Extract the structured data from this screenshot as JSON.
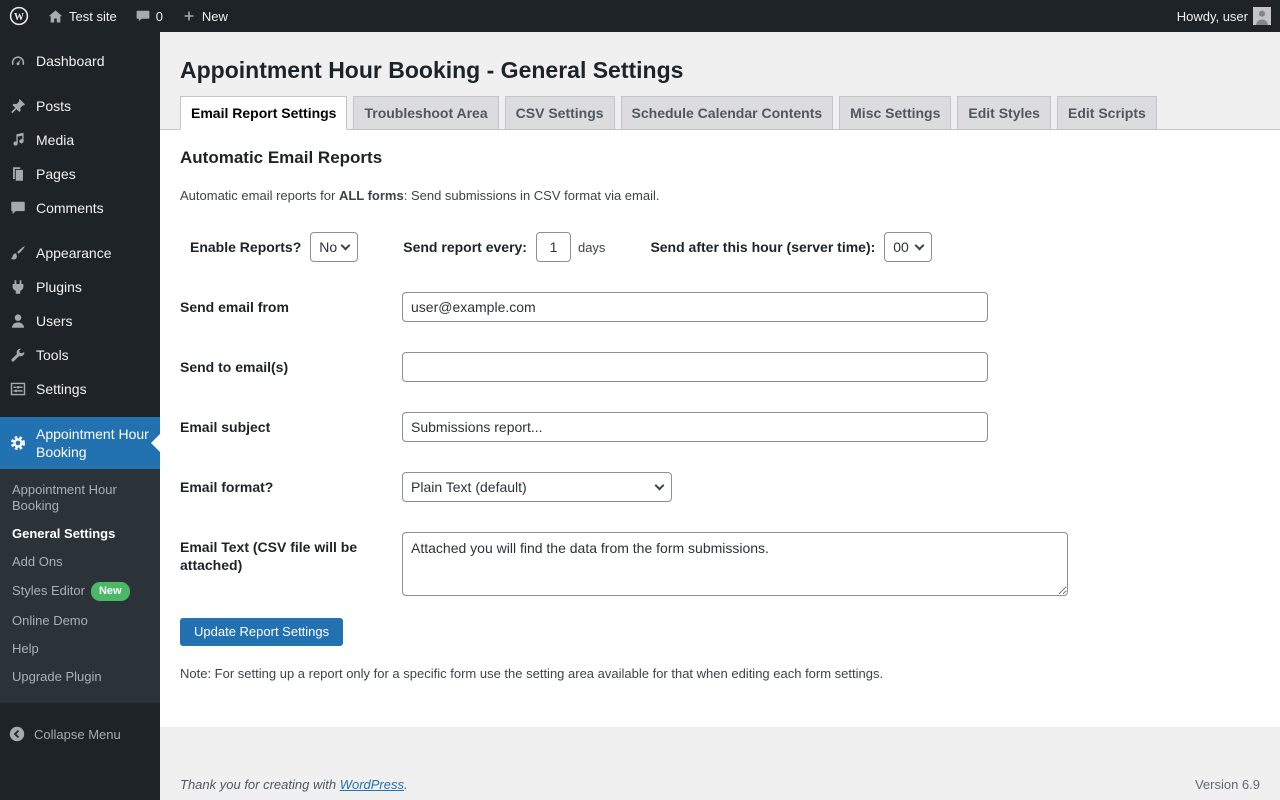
{
  "admin_bar": {
    "site_name": "Test site",
    "comments_count": "0",
    "new_label": "New",
    "howdy": "Howdy, user"
  },
  "sidebar": {
    "items": [
      {
        "label": "Dashboard"
      },
      {
        "label": "Posts"
      },
      {
        "label": "Media"
      },
      {
        "label": "Pages"
      },
      {
        "label": "Comments"
      },
      {
        "label": "Appearance"
      },
      {
        "label": "Plugins"
      },
      {
        "label": "Users"
      },
      {
        "label": "Tools"
      },
      {
        "label": "Settings"
      },
      {
        "label": "Appointment Hour Booking",
        "active": true
      }
    ],
    "submenu": [
      {
        "label": "Appointment Hour Booking"
      },
      {
        "label": "General Settings",
        "current": true
      },
      {
        "label": "Add Ons"
      },
      {
        "label": "Styles Editor",
        "badge": "New"
      },
      {
        "label": "Online Demo"
      },
      {
        "label": "Help"
      },
      {
        "label": "Upgrade Plugin"
      }
    ],
    "collapse_label": "Collapse Menu"
  },
  "page": {
    "title": "Appointment Hour Booking - General Settings",
    "tabs": [
      {
        "label": "Email Report Settings",
        "active": true
      },
      {
        "label": "Troubleshoot Area"
      },
      {
        "label": "CSV Settings"
      },
      {
        "label": "Schedule Calendar Contents"
      },
      {
        "label": "Misc Settings"
      },
      {
        "label": "Edit Styles"
      },
      {
        "label": "Edit Scripts"
      }
    ],
    "section_title": "Automatic Email Reports",
    "intro_prefix": "Automatic email reports for ",
    "intro_bold": "ALL forms",
    "intro_suffix": ": Send submissions in CSV format via email.",
    "form": {
      "enable_label": "Enable Reports?",
      "enable_value": "No",
      "every_label": "Send report every:",
      "every_value": "1",
      "every_suffix": "days",
      "hour_label": "Send after this hour (server time):",
      "hour_value": "00",
      "from_label": "Send email from",
      "from_value": "user@example.com",
      "to_label": "Send to email(s)",
      "to_value": "",
      "subject_label": "Email subject",
      "subject_value": "Submissions report...",
      "format_label": "Email format?",
      "format_value": "Plain Text (default)",
      "text_label": "Email Text (CSV file will be attached)",
      "text_value": "Attached you will find the data from the form submissions.",
      "submit_label": "Update Report Settings"
    },
    "note": "Note: For setting up a report only for a specific form use the setting area available for that when editing each form settings."
  },
  "footer": {
    "thanks_prefix": "Thank you for creating with ",
    "link": "WordPress",
    "thanks_suffix": ".",
    "version": "Version 6.9"
  },
  "colors": {
    "accent_blue": "#2271b1",
    "admin_bar_bg": "#1d2327",
    "sidebar_bg": "#1d2327",
    "submenu_bg": "#2c3338",
    "page_bg": "#f0f0f1",
    "panel_bg": "#ffffff",
    "badge_green": "#4ab866"
  },
  "icons": {
    "wp_logo_glyph": "W",
    "wordpress-logo-icon": "outlined W in circle",
    "home-icon": "house",
    "comments-bubble-icon": "speech bubble",
    "plus-icon": "plus",
    "avatar-icon": "user silhouette",
    "dashboard-icon": "gauge",
    "posts-icon": "pushpin",
    "media-icon": "musical note",
    "pages-icon": "stacked pages",
    "comments-icon": "speech bubble",
    "appearance-icon": "paintbrush",
    "plugins-icon": "plug",
    "users-icon": "person",
    "tools-icon": "wrench",
    "settings-icon": "control sliders",
    "appointment-gear-icon": "gear",
    "collapse-icon": "circled left chevron",
    "chevron-down-icon": "chevron down"
  }
}
